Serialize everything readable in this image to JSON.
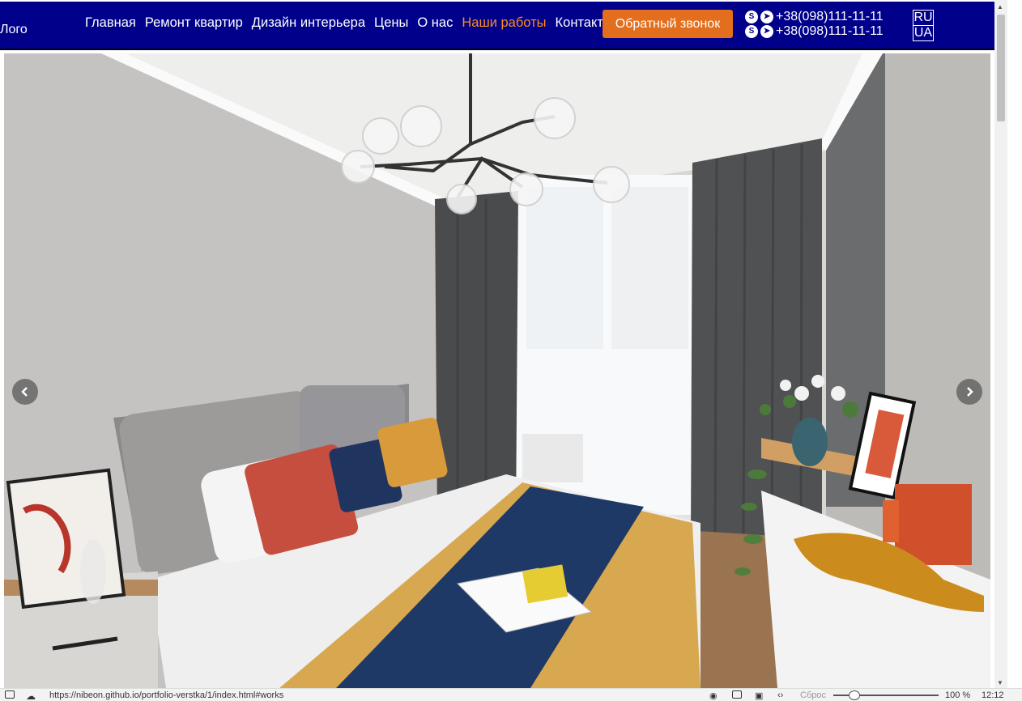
{
  "header": {
    "logo": "Лого",
    "nav": [
      {
        "label": "Главная"
      },
      {
        "label": "Ремонт квартир"
      },
      {
        "label": "Дизайн интерьера"
      },
      {
        "label": "Цены"
      },
      {
        "label": "О нас"
      },
      {
        "label": "Наши работы",
        "active": true
      },
      {
        "label": "Контакты"
      }
    ],
    "callback_label": "Обратный звонок",
    "phones": [
      "+38(098)111-11-11",
      "+38(098)111-11-11"
    ],
    "phone_icons": [
      "skype-icon",
      "telegram-icon"
    ],
    "languages": [
      "RU",
      "UA"
    ]
  },
  "slider": {
    "icons": {
      "prev": "chevron-left-icon",
      "next": "chevron-right-icon"
    }
  },
  "statusbar": {
    "url": "https://nibeon.github.io/portfolio-verstka/1/index.html#works",
    "reset_label": "Сброс",
    "zoom": "100 %",
    "time": "12:12"
  },
  "colors": {
    "header_bg": "#00008b",
    "active_link": "#ff8c1a",
    "callback_bg": "#e36f1e"
  }
}
